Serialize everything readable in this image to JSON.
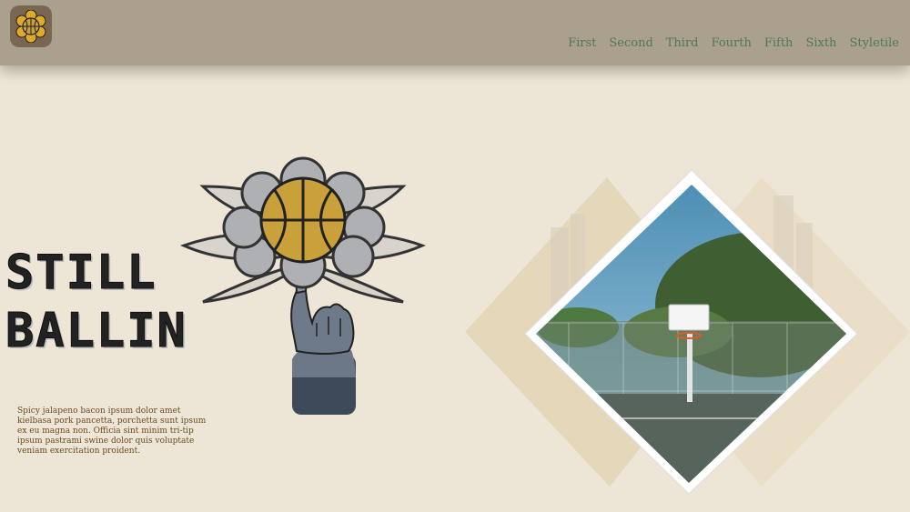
{
  "nav": {
    "items": [
      "First",
      "Second",
      "Third",
      "Fourth",
      "Fifth",
      "Sixth",
      "Styletile"
    ]
  },
  "hero": {
    "title_line1": "STILL",
    "title_line2": "BALLIN",
    "description": "Spicy jalapeno bacon ipsum dolor amet kielbasa pork pancetta, porchetta sunt ipsum ex eu magna non. Officia sint minim tri-tip ipsum pastrami swine dolor quis voluptate veniam exercitation proident."
  },
  "colors": {
    "header_bg": "#ab9f8d",
    "page_bg": "#ede5d5",
    "nav_text": "#4e7a58",
    "blurb_text": "#6b4a1f",
    "ball": "#c9a03a"
  },
  "icons": [
    "basketball-flower-logo-icon"
  ]
}
